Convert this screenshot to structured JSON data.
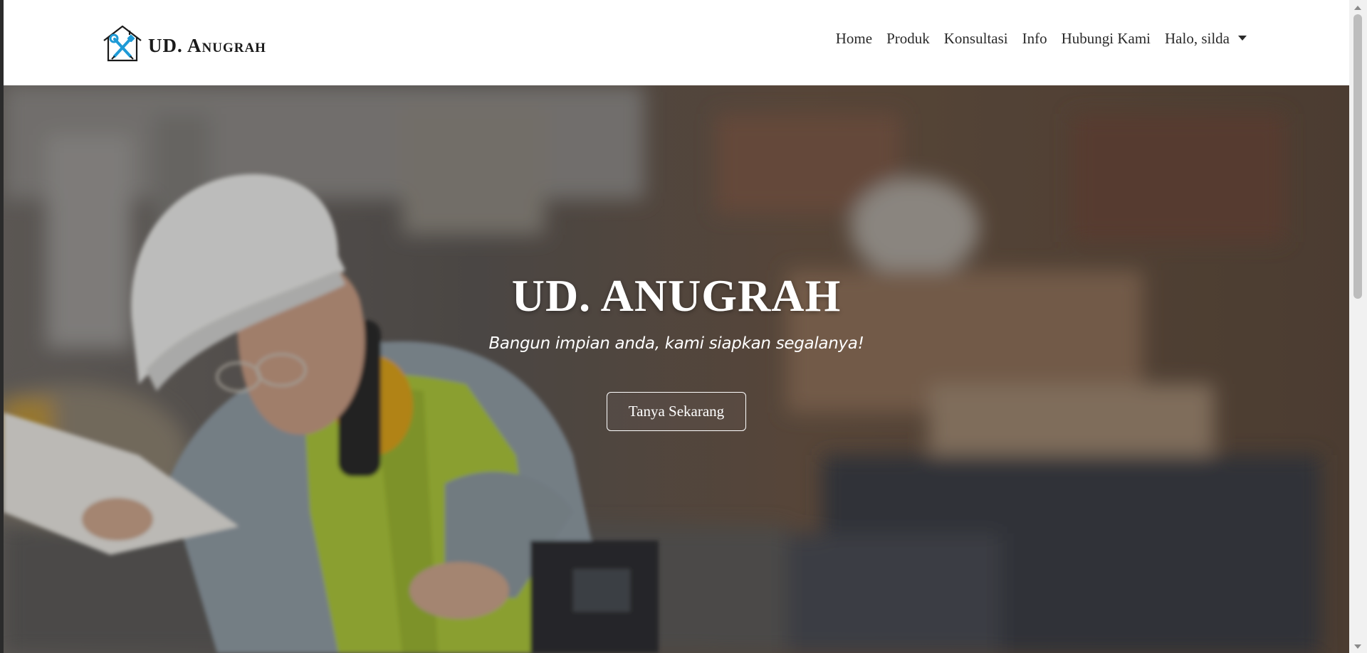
{
  "brand": {
    "name": "UD. Anugrah",
    "logo_icon": "house-tools-icon",
    "accent_color": "#1e9ad6"
  },
  "nav": {
    "items": [
      {
        "label": "Home"
      },
      {
        "label": "Produk"
      },
      {
        "label": "Konsultasi"
      },
      {
        "label": "Info"
      },
      {
        "label": "Hubungi Kami"
      },
      {
        "label": "Halo, silda",
        "icon": "caret-down-icon"
      }
    ]
  },
  "hero": {
    "title": "UD. ANUGRAH",
    "subtitle": "Bangun impian anda, kami siapkan segalanya!",
    "cta_label": "Tanya Sekarang",
    "background_image": "construction-worker-photo"
  }
}
